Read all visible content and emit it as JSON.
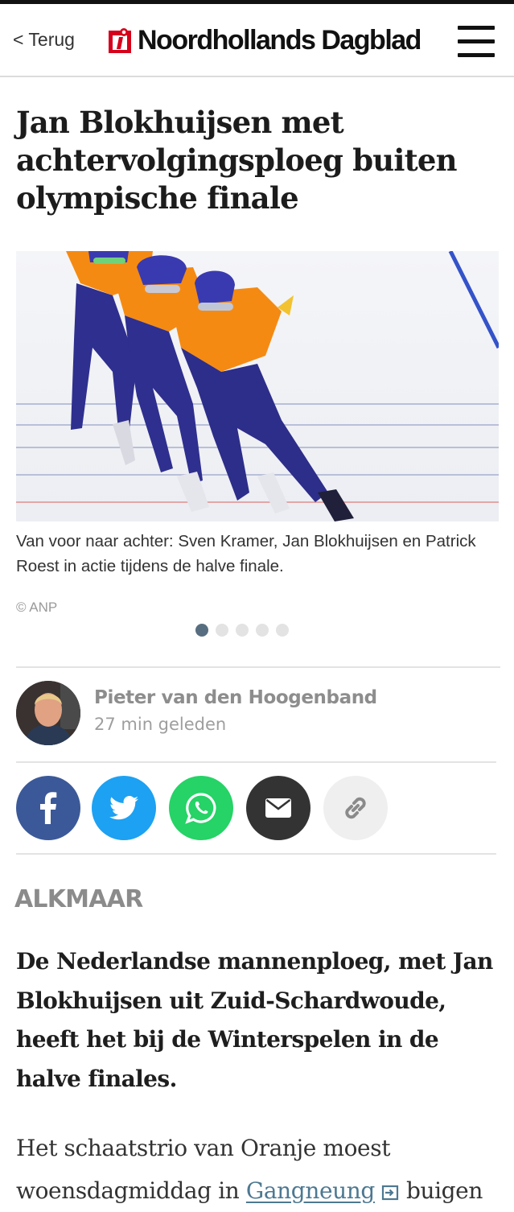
{
  "header": {
    "back_label": "< Terug",
    "logo_text": "Noordhollands Dagblad",
    "menu_icon": "hamburger-menu-icon"
  },
  "article": {
    "headline": "Jan Blokhuijsen met achtervolgingsploeg buiten olympische finale",
    "caption": "Van voor naar achter: Sven Kramer, Jan Blokhuijsen en Patrick Roest in actie tijdens de halve finale.",
    "photo_credit": "© ANP",
    "slides": {
      "count": 5,
      "active_index": 0
    },
    "author": {
      "name": "Pieter van den Hoogenband",
      "time": "27 min geleden"
    },
    "share": [
      {
        "icon": "facebook-icon",
        "color": "#3b5998"
      },
      {
        "icon": "twitter-icon",
        "color": "#1da1f2"
      },
      {
        "icon": "whatsapp-icon",
        "color": "#25d366"
      },
      {
        "icon": "email-icon",
        "color": "#333333"
      },
      {
        "icon": "link-icon",
        "color": "#efefef"
      }
    ],
    "location": "ALKMAAR",
    "lead": "De Nederlandse mannenploeg, met Jan Blokhuijsen uit Zuid-Schardwoude, heeft het bij de Winterspelen in de halve finales.",
    "body_before_link": "Het schaatstrio van Oranje moest woensdagmiddag in ",
    "body_link": "Gangneung",
    "body_after_link": " buigen"
  },
  "colors": {
    "accent": "#d6001c",
    "link": "#4d7891",
    "dot_active": "#576e80"
  }
}
